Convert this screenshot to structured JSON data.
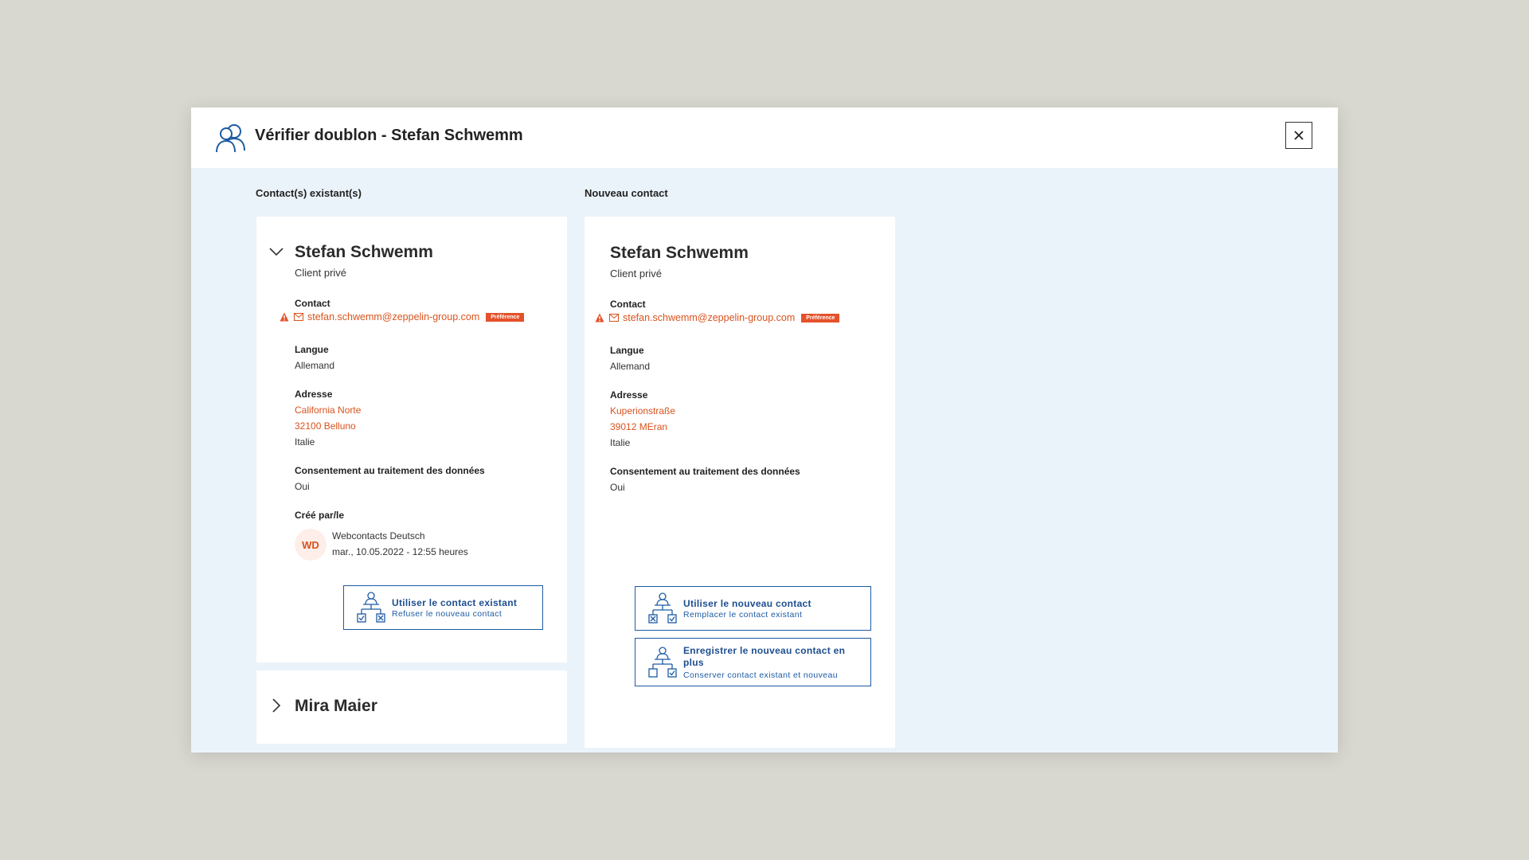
{
  "dialog": {
    "title": "Vérifier doublon - Stefan Schwemm",
    "icon": "users-icon",
    "close_icon": "close-icon"
  },
  "columns": {
    "existing_heading": "Contact(s) existant(s)",
    "new_heading": "Nouveau contact"
  },
  "existing": {
    "name": "Stefan Schwemm",
    "type": "Client privé",
    "contact_label": "Contact",
    "email": "stefan.schwemm@zeppelin-group.com",
    "badge": "Préférence",
    "language_label": "Langue",
    "language": "Allemand",
    "address_label": "Adresse",
    "address_street": "California Norte",
    "address_city": "32100 Belluno",
    "address_country": "Italie",
    "consent_label": "Consentement au traitement des données",
    "consent": "Oui",
    "created_label": "Créé par/le",
    "avatar_initials": "WD",
    "creator": "Webcontacts Deutsch",
    "created_at": "mar., 10.05.2022 - 12:55 heures",
    "use_button_title": "Utiliser le contact existant",
    "use_button_sub": "Refuser le nouveau contact"
  },
  "other_existing": {
    "name": "Mira Maier"
  },
  "new_contact": {
    "name": "Stefan Schwemm",
    "type": "Client privé",
    "contact_label": "Contact",
    "email": "stefan.schwemm@zeppelin-group.com",
    "badge": "Préférence",
    "language_label": "Langue",
    "language": "Allemand",
    "address_label": "Adresse",
    "address_street": "Kuperionstraße",
    "address_city": "39012 MEran",
    "address_country": "Italie",
    "consent_label": "Consentement au traitement des données",
    "consent": "Oui",
    "use_button_title": "Utiliser le nouveau contact",
    "use_button_sub": "Remplacer le contact existant",
    "save_button_title": "Enregistrer le nouveau contact en plus",
    "save_button_sub": "Conserver contact existant et nouveau"
  },
  "colors": {
    "accent_blue": "#1d5aa3",
    "link_orange": "#d9531e",
    "badge_orange": "#e4512a",
    "panel_bg": "#ebf3fa"
  }
}
